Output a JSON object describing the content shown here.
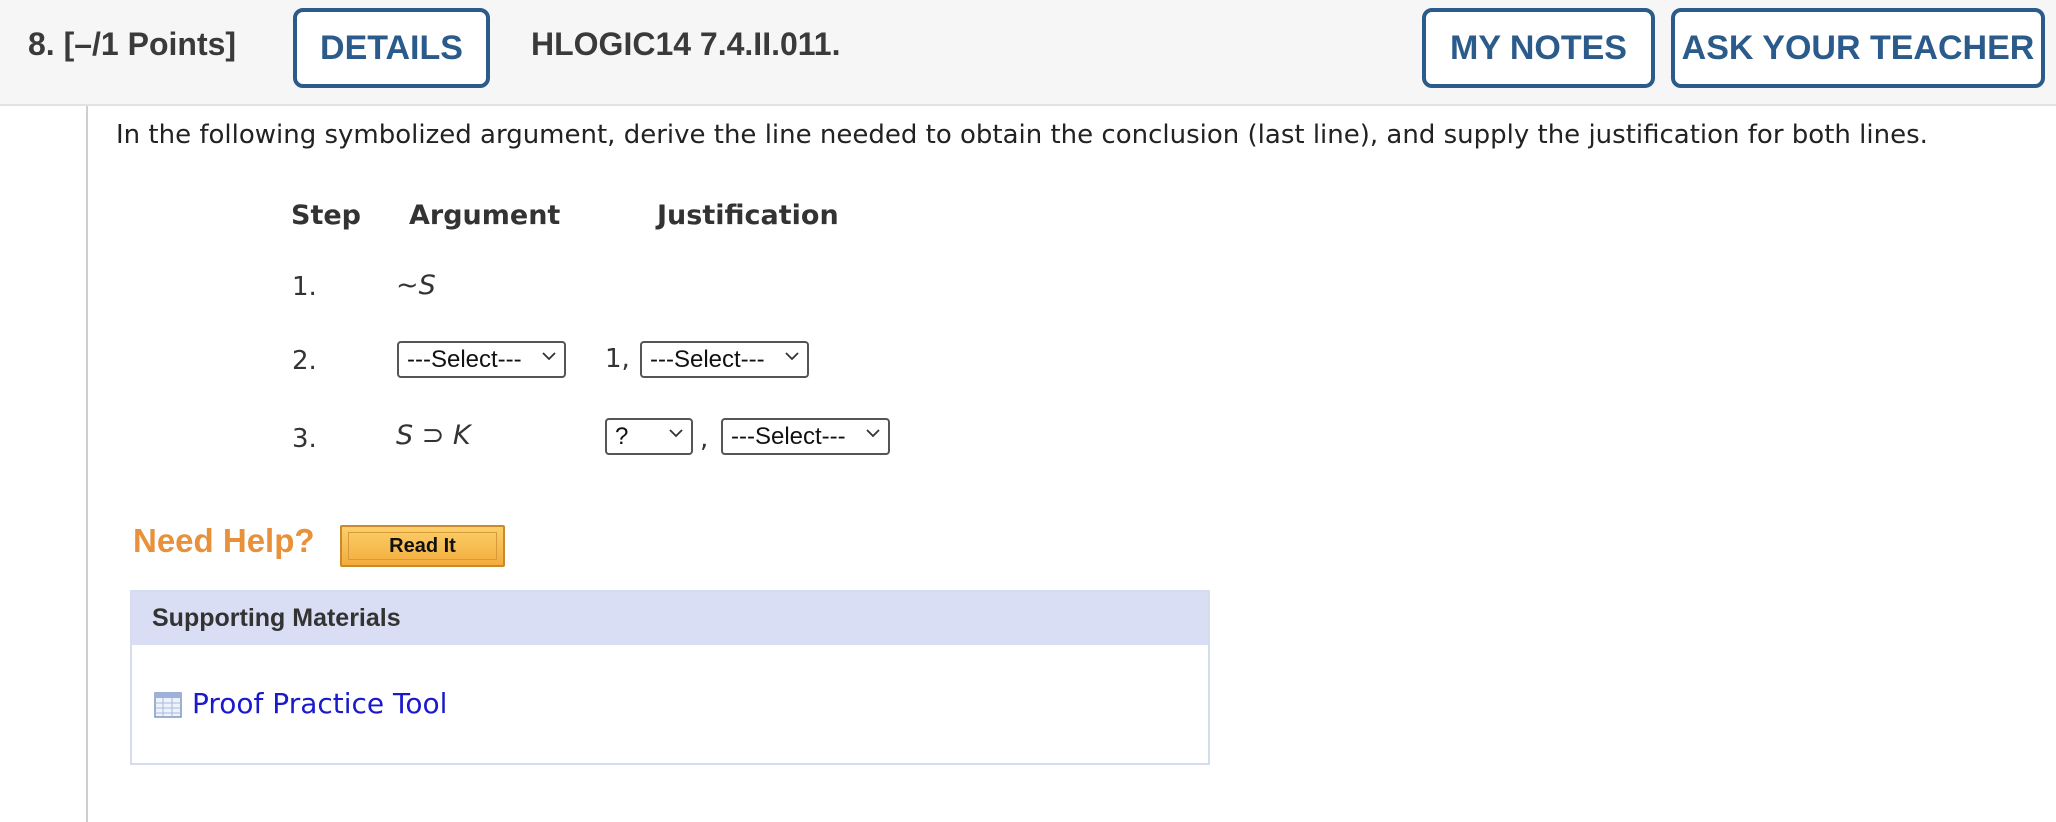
{
  "header": {
    "question_number": "8.",
    "points": "[–/1 Points]",
    "details_label": "DETAILS",
    "code": "HLOGIC14 7.4.II.011.",
    "my_notes_label": "MY NOTES",
    "ask_teacher_label": "ASK YOUR TEACHER"
  },
  "instruction": "In the following symbolized argument, derive the line needed to obtain the conclusion (last line), and supply the justification for both lines.",
  "table": {
    "headers": {
      "step": "Step",
      "argument": "Argument",
      "justification": "Justification"
    },
    "rows": [
      {
        "step": "1.",
        "argument": "~S"
      },
      {
        "step": "2.",
        "argument_select": "---Select---",
        "just_prefix": "1,",
        "just_select": "---Select---"
      },
      {
        "step": "3.",
        "argument": "S ⊃ K",
        "just_line_select": "?",
        "separator": ",",
        "just_select": "---Select---"
      }
    ]
  },
  "help": {
    "need_help": "Need Help?",
    "read_it": "Read It"
  },
  "support": {
    "title": "Supporting Materials",
    "link": "Proof Practice Tool"
  },
  "colors": {
    "accent_blue": "#2b5b8a",
    "need_help_orange": "#e8913a",
    "link_blue": "#1a1acc",
    "panel_header": "#d9def4"
  }
}
